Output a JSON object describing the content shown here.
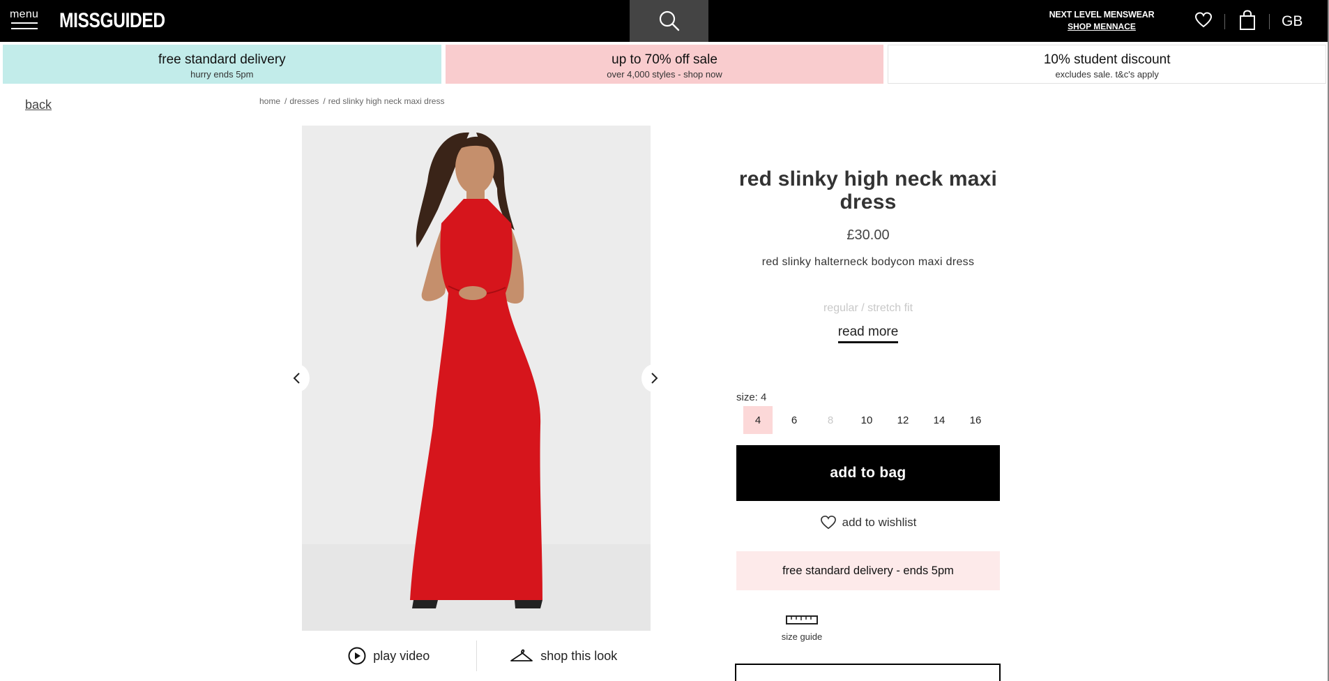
{
  "header": {
    "menu_label": "menu",
    "logo": "MISSGUIDED",
    "promo_line1": "NEXT LEVEL MENSWEAR",
    "promo_line2": "SHOP MENNACE",
    "country": "GB",
    "icons": [
      "search-icon",
      "heart-icon",
      "bag-icon"
    ]
  },
  "promos": [
    {
      "title": "free standard delivery",
      "subtitle": "hurry ends 5pm",
      "color": "#c2ecea"
    },
    {
      "title": "up to 70% off sale",
      "subtitle": "over 4,000 styles - shop now",
      "color": "#f9ccce"
    },
    {
      "title": "10% student discount",
      "subtitle": "excludes sale. t&c's apply",
      "color": "#ffffff"
    }
  ],
  "back_label": "back",
  "breadcrumb": [
    "home",
    "dresses",
    "red slinky high neck maxi dress"
  ],
  "product": {
    "title": "red slinky high neck maxi dress",
    "price": "£30.00",
    "description": "red slinky halterneck bodycon maxi dress",
    "fit": "regular / stretch fit",
    "read_more": "read more",
    "size_label": "size: 4",
    "sizes": [
      "4",
      "6",
      "8",
      "10",
      "12",
      "14",
      "16"
    ],
    "selected_size": "4",
    "unavailable_size": "8",
    "add_to_bag": "add to bag",
    "add_to_wishlist": "add to wishlist",
    "delivery_note": "free standard delivery - ends 5pm",
    "size_guide": "size guide",
    "dress_color": "#d6151c"
  },
  "media": {
    "play_video": "play video",
    "shop_this_look": "shop this look"
  }
}
